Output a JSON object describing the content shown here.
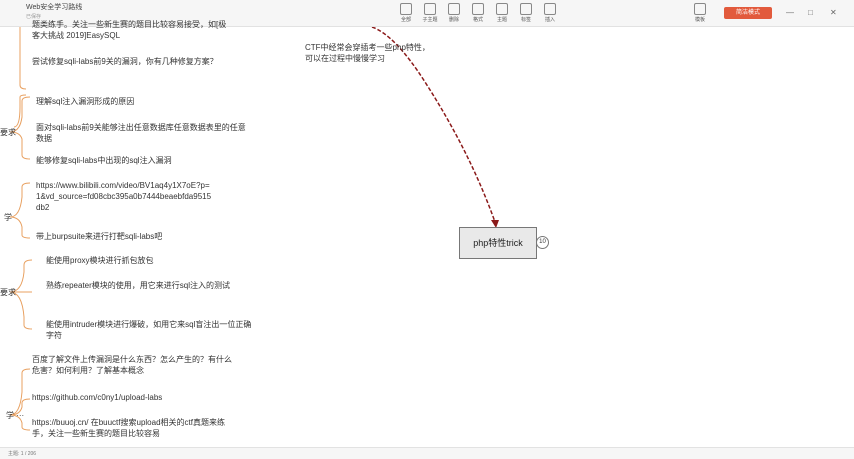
{
  "window": {
    "doc_title": "Web安全学习路线",
    "doc_subtitle": "已保存",
    "toolbar": [
      {
        "label": "全部",
        "icon": "layout-icon"
      },
      {
        "label": "子主题",
        "icon": "subtopic-icon"
      },
      {
        "label": "删除",
        "icon": "delete-icon"
      },
      {
        "label": "格式",
        "icon": "format-icon"
      },
      {
        "label": "主题",
        "icon": "theme-icon"
      },
      {
        "label": "标签",
        "icon": "tag-icon"
      },
      {
        "label": "插入",
        "icon": "insert-icon"
      }
    ],
    "right_button": "简洁模式",
    "right_icon_label": "模板"
  },
  "mindmap": {
    "top_partial": "题类练手。关注一些新生赛的题目比较容易接受，如[极客大挑战 2019]EasySQL",
    "sqli_fix_question": "尝试修复sqli-labs前9关的漏洞，你有几种修复方案？",
    "req_label": "要求",
    "req_items": [
      "理解sql注入漏洞形成的原因",
      "面对sqli-labs前9关能够注出任意数据库任意数据表里的任意数据",
      "能够修复sqli-labs中出现的sql注入漏洞"
    ],
    "learn_label": "学",
    "learn_url": "https://www.bilibili.com/video/BV1aq4y1X7oE?p=1&vd_source=fd08cbc395a0b7444beaebfda9515db2",
    "learn_burp": "带上burpsuite来进行打靶sqli-labs吧",
    "burp_req_label": "要求",
    "burp_items": [
      "能使用proxy模块进行抓包放包",
      "熟练repeater模块的使用，用它来进行sql注入的测试",
      "能使用intruder模块进行爆破，如用它来sql盲注出一位正确字符"
    ],
    "upload_label": "学 ···",
    "upload_items": [
      "百度了解文件上传漏洞是什么东西？怎么产生的？有什么危害？如何利用？了解基本概念",
      "https://github.com/c0ny1/upload-labs",
      "https://buuoj.cn/ 在buuctf搜索upload相关的ctf真题来练手，关注一些新生赛的题目比较容易"
    ],
    "note_text": "CTF中经常会穿插考一些php特性，可以在过程中慢慢学习",
    "trick_node": "php特性trick",
    "trick_badge": "10"
  },
  "statusbar": {
    "left": "主题: 1 / 206",
    "page": "",
    "zoom": ""
  },
  "colors": {
    "connector": "#8b1a1a",
    "branch_line": "#e8a060",
    "accent": "#e25a3c"
  }
}
